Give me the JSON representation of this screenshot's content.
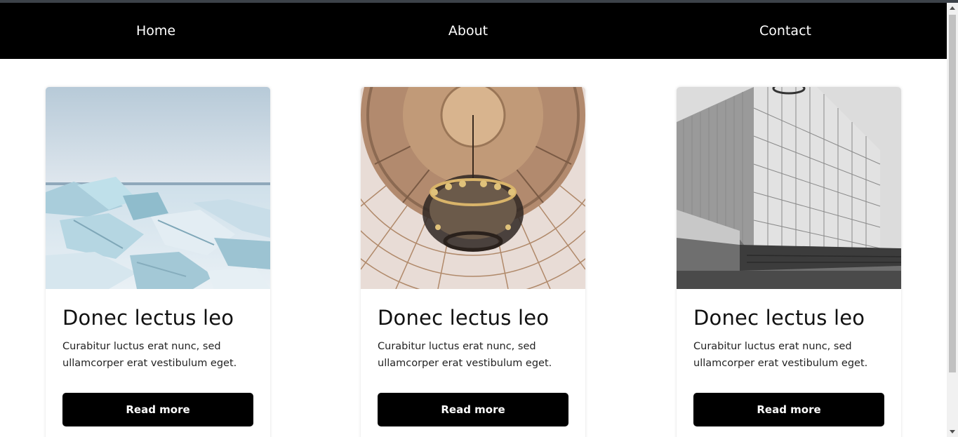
{
  "nav": {
    "items": [
      {
        "label": "Home"
      },
      {
        "label": "About"
      },
      {
        "label": "Contact"
      }
    ]
  },
  "cards": [
    {
      "title": "Donec lectus leo",
      "text": "Curabitur luctus erat nunc, sed ullamcorper erat vestibulum eget.",
      "button_label": "Read more",
      "image": "frozen-lake-ice-photo"
    },
    {
      "title": "Donec lectus leo",
      "text": "Curabitur luctus erat nunc, sed ullamcorper erat vestibulum eget.",
      "button_label": "Read more",
      "image": "dome-chandelier-photo"
    },
    {
      "title": "Donec lectus leo",
      "text": "Curabitur luctus erat nunc, sed ullamcorper erat vestibulum eget.",
      "button_label": "Read more",
      "image": "tower-building-photo"
    }
  ],
  "colors": {
    "navbar": "#000000",
    "nav_text": "#ffffff",
    "button": "#000000",
    "button_text": "#ffffff"
  }
}
